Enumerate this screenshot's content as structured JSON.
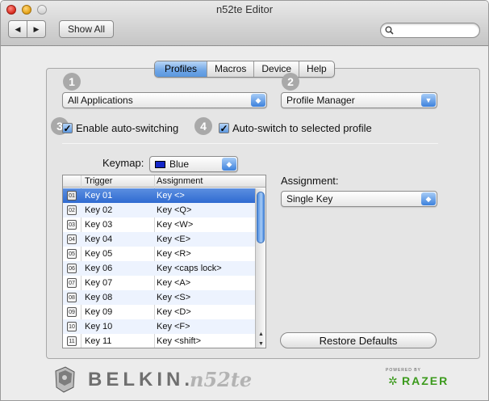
{
  "window": {
    "title": "n52te Editor"
  },
  "toolbar": {
    "back_icon": "◀",
    "forward_icon": "▶",
    "show_all_label": "Show All",
    "search_placeholder": "",
    "search_icon": "magnifier-icon"
  },
  "tabs": [
    {
      "label": "Profiles",
      "active": true
    },
    {
      "label": "Macros",
      "active": false
    },
    {
      "label": "Device",
      "active": false
    },
    {
      "label": "Help",
      "active": false
    }
  ],
  "steps": [
    "1",
    "2",
    "3",
    "4"
  ],
  "application_popup": {
    "value": "All Applications"
  },
  "profile_popup": {
    "value": "Profile Manager"
  },
  "enable_autoswitch": {
    "label": "Enable auto-switching",
    "checked": true
  },
  "autoswitch_selected": {
    "label": "Auto-switch to selected profile",
    "checked": true
  },
  "keymap": {
    "label": "Keymap:",
    "value": "Blue",
    "color": "#1426c8"
  },
  "table": {
    "headers": {
      "trigger": "Trigger",
      "assignment": "Assignment"
    },
    "rows": [
      {
        "icon": "01",
        "trigger": "Key 01",
        "assignment": "Key <>",
        "selected": true
      },
      {
        "icon": "02",
        "trigger": "Key 02",
        "assignment": "Key <Q>"
      },
      {
        "icon": "03",
        "trigger": "Key 03",
        "assignment": "Key <W>"
      },
      {
        "icon": "04",
        "trigger": "Key 04",
        "assignment": "Key <E>"
      },
      {
        "icon": "05",
        "trigger": "Key 05",
        "assignment": "Key <R>"
      },
      {
        "icon": "06",
        "trigger": "Key 06",
        "assignment": "Key <caps lock>"
      },
      {
        "icon": "07",
        "trigger": "Key 07",
        "assignment": "Key <A>"
      },
      {
        "icon": "08",
        "trigger": "Key 08",
        "assignment": "Key <S>"
      },
      {
        "icon": "09",
        "trigger": "Key 09",
        "assignment": "Key <D>"
      },
      {
        "icon": "10",
        "trigger": "Key 10",
        "assignment": "Key <F>"
      },
      {
        "icon": "11",
        "trigger": "Key 11",
        "assignment": "Key <shift>"
      }
    ]
  },
  "assignment": {
    "label": "Assignment:",
    "value": "Single Key"
  },
  "restore_label": "Restore Defaults",
  "footer": {
    "belkin": "BELKIN.",
    "product": "n52te",
    "powered_by": "POWERED BY",
    "razer": "RAZER"
  },
  "colors": {
    "accent": "#3c81dc",
    "selection": "#2f6bd1"
  }
}
